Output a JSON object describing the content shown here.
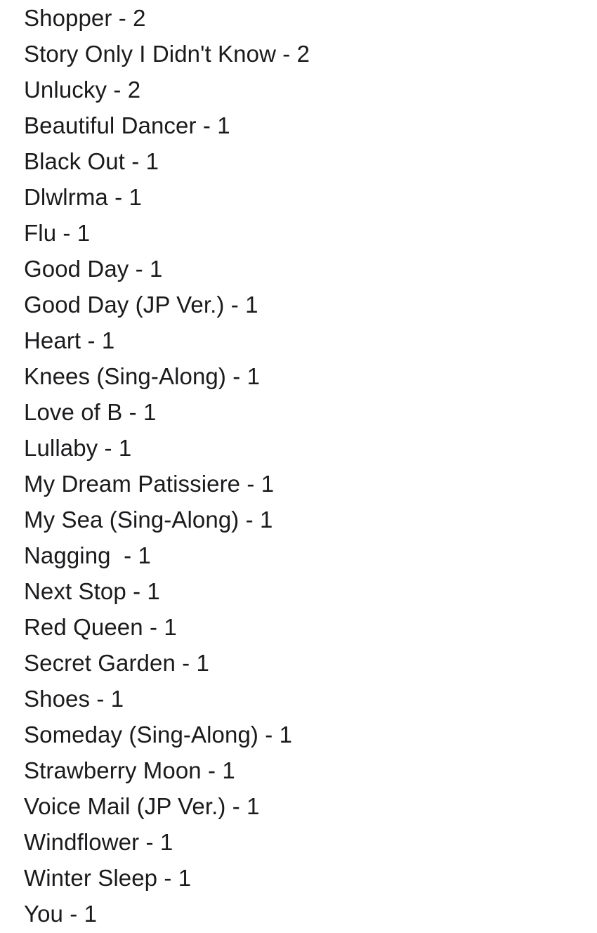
{
  "document": {
    "kind": "song-tally-list",
    "separator": " - ",
    "text_color": "#1b1b1d",
    "background_color": "#ffffff",
    "entries": [
      {
        "line": "Shopper - 2",
        "title": "Shopper",
        "count": "2"
      },
      {
        "line": "Story Only I Didn't Know - 2",
        "title": "Story Only I Didn't Know",
        "count": "2"
      },
      {
        "line": "Unlucky - 2",
        "title": "Unlucky",
        "count": "2"
      },
      {
        "line": "Beautiful Dancer - 1",
        "title": "Beautiful Dancer",
        "count": "1"
      },
      {
        "line": "Black Out - 1",
        "title": "Black Out",
        "count": "1"
      },
      {
        "line": "Dlwlrma - 1",
        "title": "Dlwlrma",
        "count": "1"
      },
      {
        "line": "Flu - 1",
        "title": "Flu",
        "count": "1"
      },
      {
        "line": "Good Day - 1",
        "title": "Good Day",
        "count": "1"
      },
      {
        "line": "Good Day (JP Ver.) - 1",
        "title": "Good Day (JP Ver.)",
        "count": "1"
      },
      {
        "line": "Heart - 1",
        "title": "Heart",
        "count": "1"
      },
      {
        "line": "Knees (Sing-Along) - 1",
        "title": "Knees (Sing-Along)",
        "count": "1"
      },
      {
        "line": "Love of B - 1",
        "title": "Love of B",
        "count": "1"
      },
      {
        "line": "Lullaby - 1",
        "title": "Lullaby",
        "count": "1"
      },
      {
        "line": "My Dream Patissiere - 1",
        "title": "My Dream Patissiere",
        "count": "1"
      },
      {
        "line": "My Sea (Sing-Along) - 1",
        "title": "My Sea (Sing-Along)",
        "count": "1"
      },
      {
        "line": "Nagging  - 1",
        "title": "Nagging ",
        "count": "1"
      },
      {
        "line": "Next Stop - 1",
        "title": "Next Stop",
        "count": "1"
      },
      {
        "line": "Red Queen - 1",
        "title": "Red Queen",
        "count": "1"
      },
      {
        "line": "Secret Garden - 1",
        "title": "Secret Garden",
        "count": "1"
      },
      {
        "line": "Shoes - 1",
        "title": "Shoes",
        "count": "1"
      },
      {
        "line": "Someday (Sing-Along) - 1",
        "title": "Someday (Sing-Along)",
        "count": "1"
      },
      {
        "line": "Strawberry Moon - 1",
        "title": "Strawberry Moon",
        "count": "1"
      },
      {
        "line": "Voice Mail (JP Ver.) - 1",
        "title": "Voice Mail (JP Ver.)",
        "count": "1"
      },
      {
        "line": "Windflower - 1",
        "title": "Windflower",
        "count": "1"
      },
      {
        "line": "Winter Sleep - 1",
        "title": "Winter Sleep",
        "count": "1"
      },
      {
        "line": "You - 1",
        "title": "You",
        "count": "1"
      }
    ]
  }
}
